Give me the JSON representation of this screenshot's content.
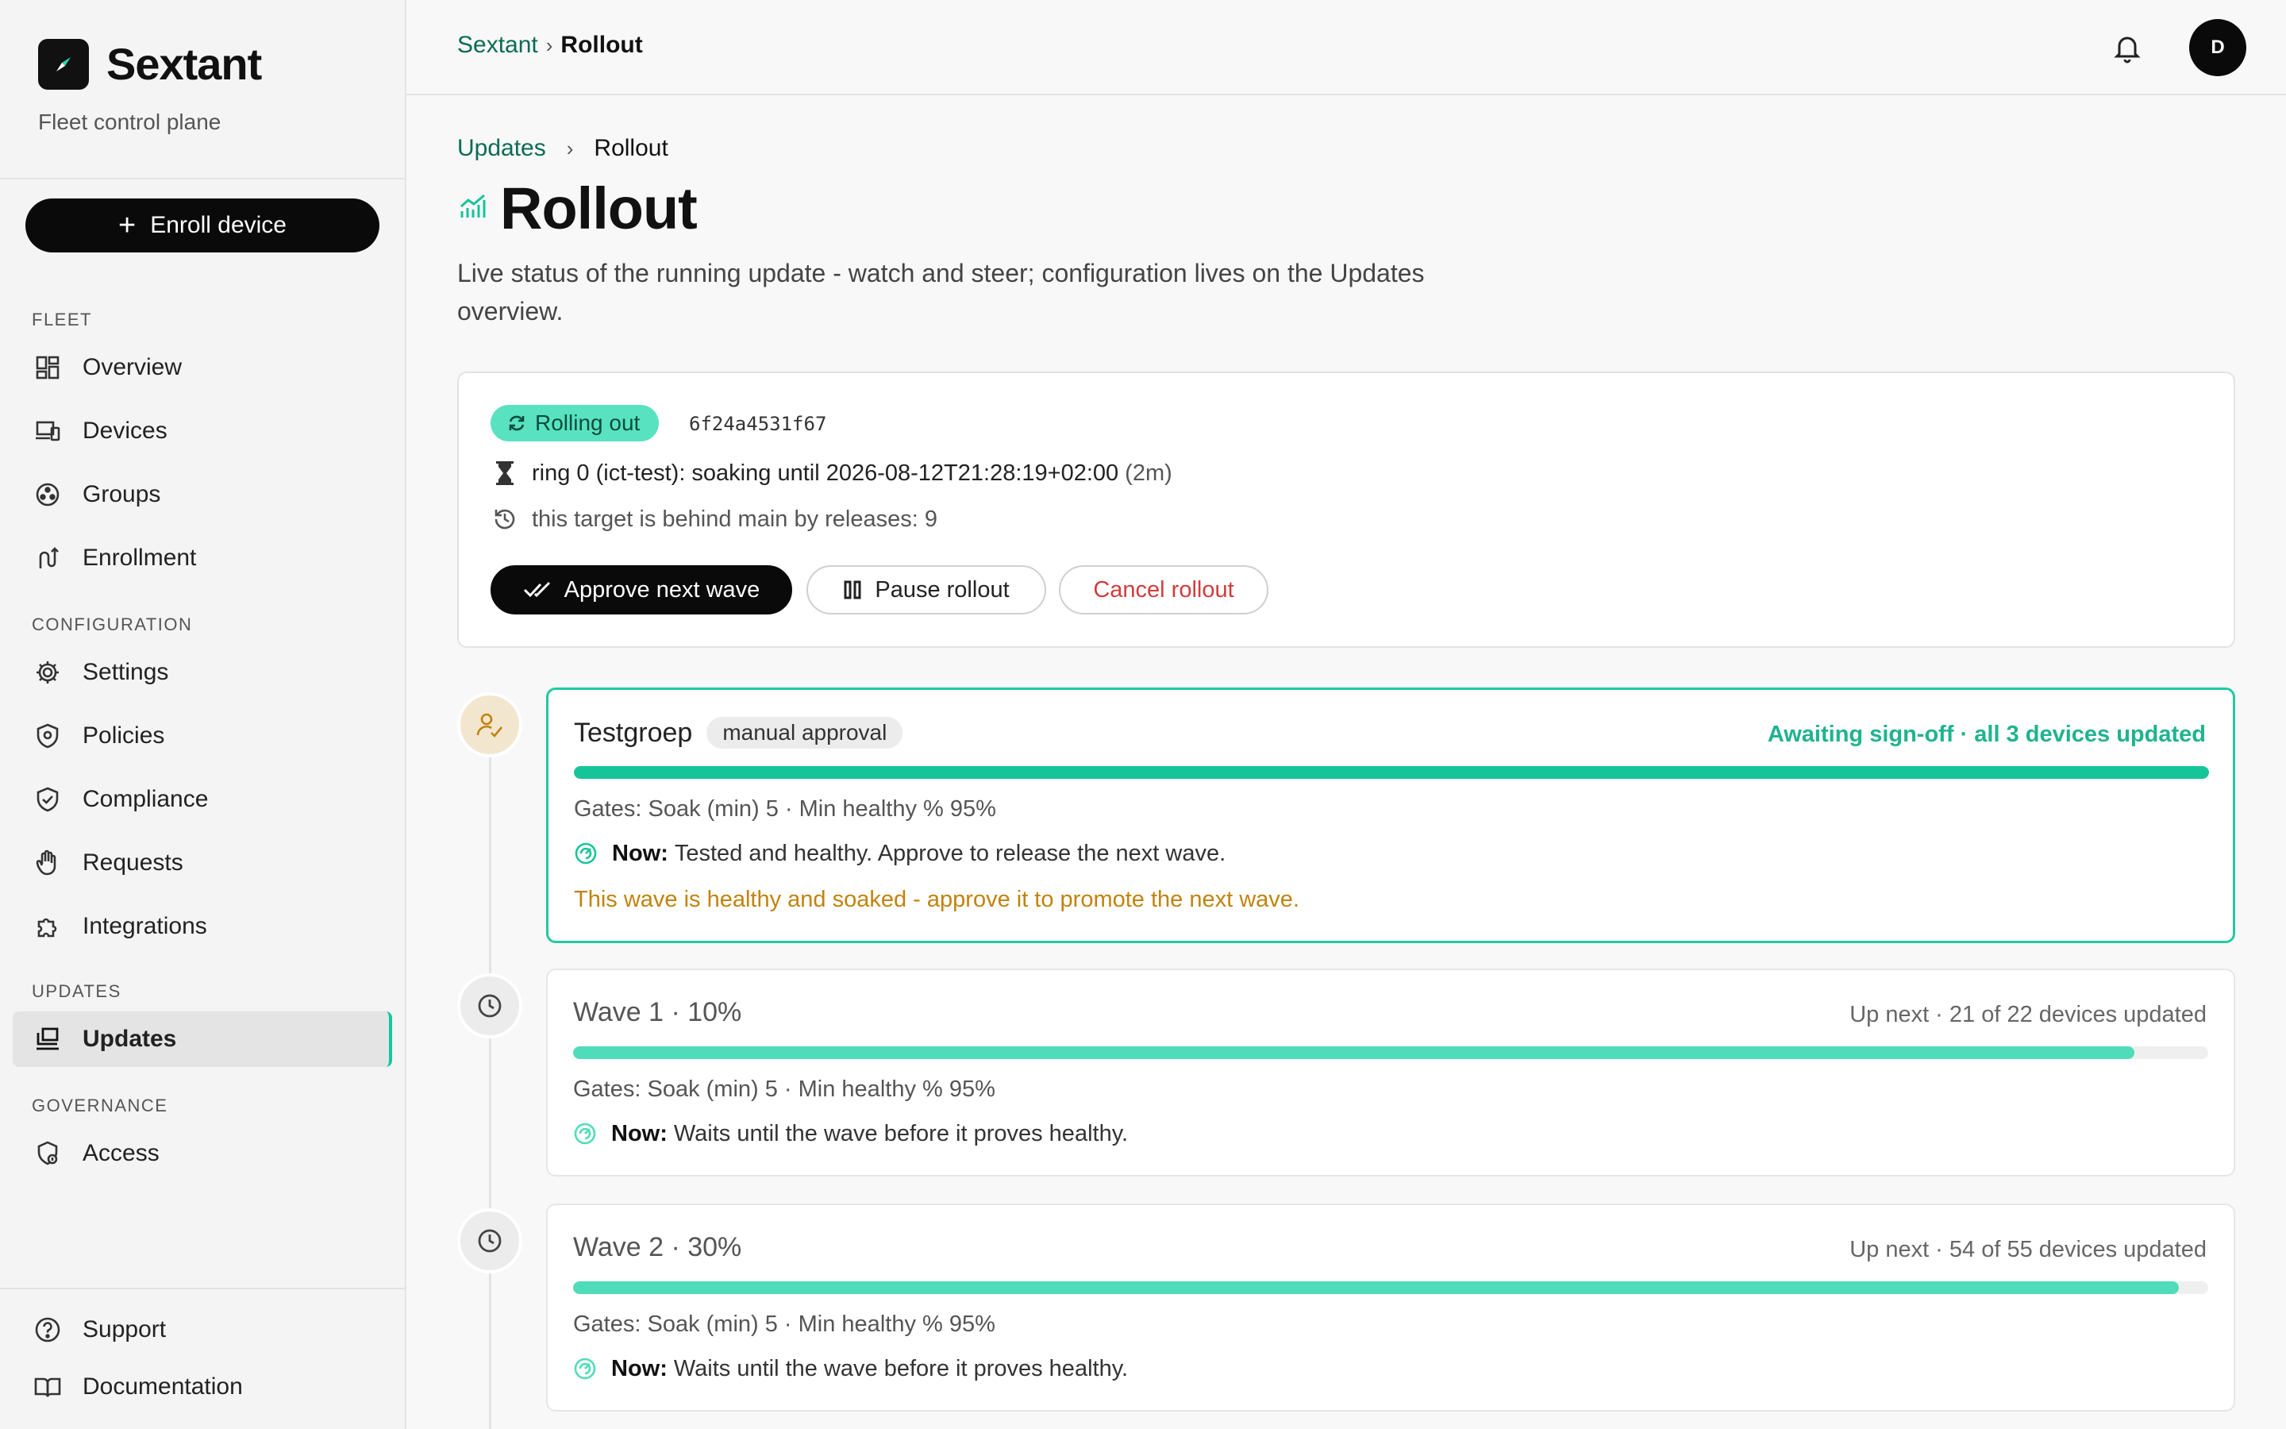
{
  "brand": {
    "name": "Sextant",
    "tagline": "Fleet control plane"
  },
  "sidebar": {
    "enroll_label": "Enroll device",
    "sections": {
      "fleet": "FLEET",
      "configuration": "CONFIGURATION",
      "updates": "UPDATES",
      "governance": "GOVERNANCE"
    },
    "items": {
      "overview": "Overview",
      "devices": "Devices",
      "groups": "Groups",
      "enrollment": "Enrollment",
      "settings": "Settings",
      "policies": "Policies",
      "compliance": "Compliance",
      "requests": "Requests",
      "integrations": "Integrations",
      "updates": "Updates",
      "access": "Access",
      "support": "Support",
      "documentation": "Documentation"
    },
    "active": "updates"
  },
  "topbar": {
    "crumb_root": "Sextant",
    "crumb_current": "Rollout",
    "avatar_initial": "D"
  },
  "page": {
    "crumb_parent": "Updates",
    "crumb_current": "Rollout",
    "title": "Rollout",
    "description": "Live status of the running update - watch and steer; configuration lives on the Updates overview."
  },
  "status": {
    "state": "Rolling out",
    "hash": "6f24a4531f67",
    "soak_line": "ring 0 (ict-test): soaking until 2026-08-12T21:28:19+02:00",
    "soak_remaining": "(2m)",
    "behind_line": "this target is behind main by releases: 9",
    "approve_label": "Approve next wave",
    "pause_label": "Pause rollout",
    "cancel_label": "Cancel rollout"
  },
  "waves": [
    {
      "name": "Testgroep",
      "badge": "manual approval",
      "status": "Awaiting sign-off · all 3 devices updated",
      "progress": 1.0,
      "gates": "Gates: Soak (min) 5 · Min healthy % 95%",
      "now_label": "Now:",
      "now_text": "Tested and healthy. Approve to release the next wave.",
      "hint": "This wave is healthy and soaked - approve it to promote the next wave."
    },
    {
      "name": "Wave 1 · 10%",
      "status": "Up next · 21 of 22 devices updated",
      "progress": 0.955,
      "gates": "Gates: Soak (min) 5 · Min healthy % 95%",
      "now_label": "Now:",
      "now_text": "Waits until the wave before it proves healthy."
    },
    {
      "name": "Wave 2 · 30%",
      "status": "Up next · 54 of 55 devices updated",
      "progress": 0.982,
      "gates": "Gates: Soak (min) 5 · Min healthy % 95%",
      "now_label": "Now:",
      "now_text": "Waits until the wave before it proves healthy."
    }
  ],
  "colors": {
    "accent": "#16c49a",
    "warning": "#c1830e",
    "danger": "#d13c3c",
    "link": "#0b6b55"
  }
}
